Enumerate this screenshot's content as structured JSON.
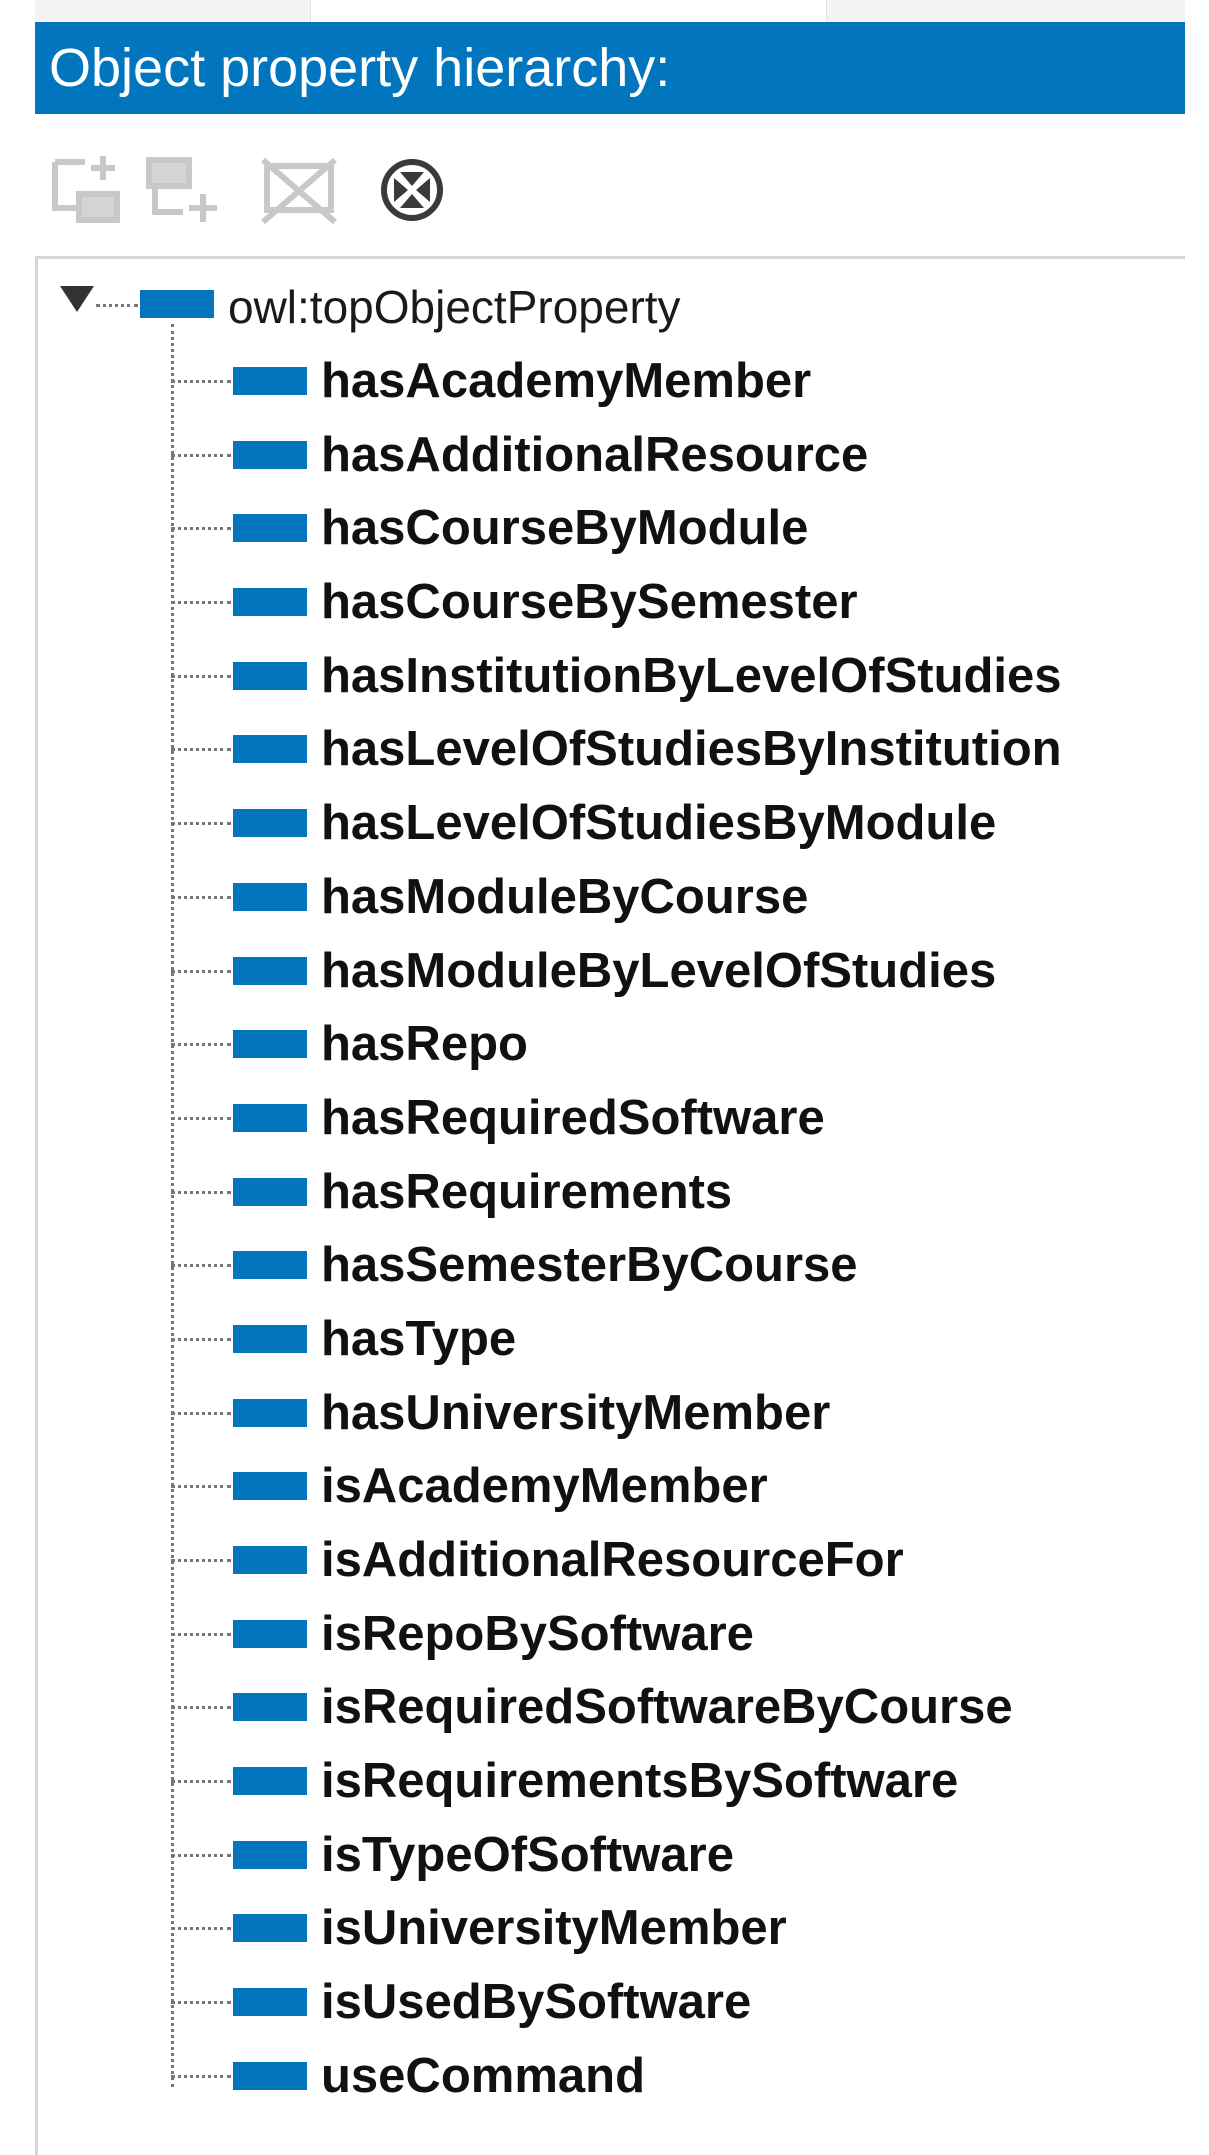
{
  "panel": {
    "title": "Object property hierarchy:"
  },
  "toolbar": {
    "buttons": [
      {
        "icon": "add-sub-property-icon",
        "enabled": false
      },
      {
        "icon": "add-sibling-property-icon",
        "enabled": false
      },
      {
        "icon": "delete-property-icon",
        "enabled": false
      },
      {
        "icon": "find-usage-icon",
        "enabled": true
      }
    ]
  },
  "colors": {
    "header_bg": "#0275bf",
    "property_icon": "#0275bf",
    "disabled_icon": "#c8c8c8",
    "enabled_icon": "#3a3a3a"
  },
  "tree": {
    "root": {
      "label": "owl:topObjectProperty",
      "expanded": true
    },
    "children": [
      "hasAcademyMember",
      "hasAdditionalResource",
      "hasCourseByModule",
      "hasCourseBySemester",
      "hasInstitutionByLevelOfStudies",
      "hasLevelOfStudiesByInstitution",
      "hasLevelOfStudiesByModule",
      "hasModuleByCourse",
      "hasModuleByLevelOfStudies",
      "hasRepo",
      "hasRequiredSoftware",
      "hasRequirements",
      "hasSemesterByCourse",
      "hasType",
      "hasUniversityMember",
      "isAcademyMember",
      "isAdditionalResourceFor",
      "isRepoBySoftware",
      "isRequiredSoftwareByCourse",
      "isRequirementsBySoftware",
      "isTypeOfSoftware",
      "isUniversityMember",
      "isUsedBySoftware",
      "useCommand"
    ]
  }
}
